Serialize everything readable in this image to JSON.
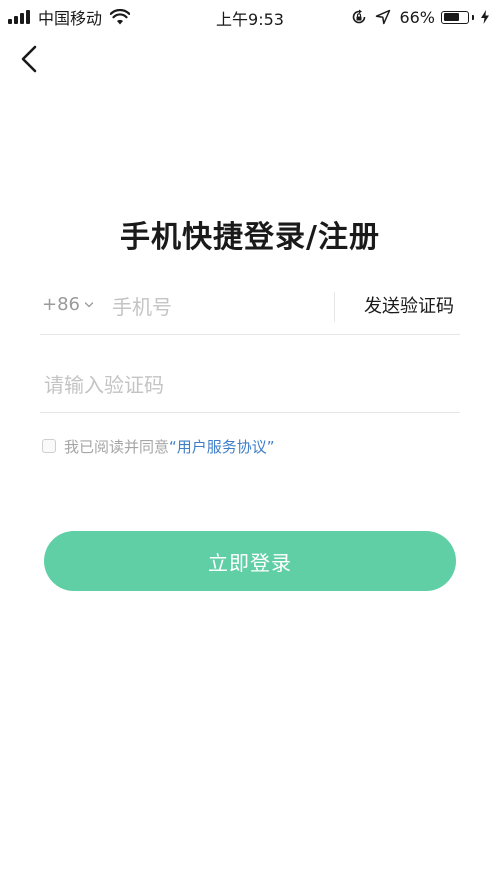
{
  "status_bar": {
    "carrier": "中国移动",
    "time": "上午9:53",
    "battery_percent": "66%",
    "battery_level": 0.66
  },
  "page": {
    "title": "手机快捷登录/注册"
  },
  "phone_field": {
    "country_code": "+86",
    "placeholder": "手机号",
    "value": "",
    "send_code_label": "发送验证码"
  },
  "code_field": {
    "placeholder": "请输入验证码",
    "value": ""
  },
  "agreement": {
    "checked": false,
    "prefix_text": "我已阅读并同意",
    "link_text": "“用户服务协议”"
  },
  "login_button": {
    "label": "立即登录",
    "color": "#60cfa6"
  },
  "colors": {
    "accent": "#60cfa6",
    "link": "#3f7fc9",
    "placeholder": "#c4c4c4"
  },
  "icons": {
    "back": "back-chevron-icon",
    "signal": "signal-icon",
    "wifi": "wifi-icon",
    "rotation_lock": "rotation-lock-icon",
    "location": "location-icon",
    "battery": "battery-icon",
    "charging": "charging-icon",
    "dropdown": "chevron-down-icon"
  }
}
